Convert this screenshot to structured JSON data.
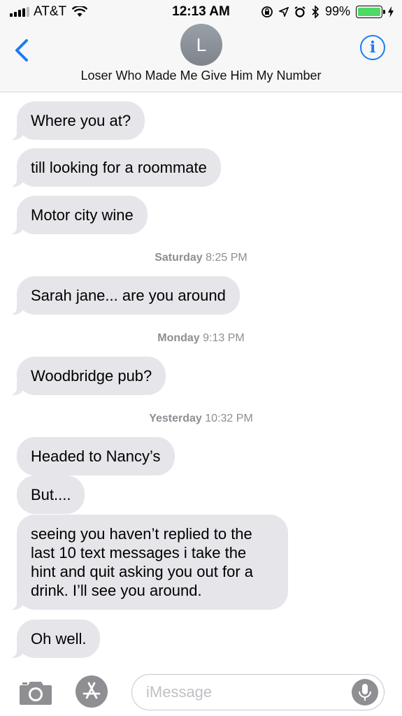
{
  "status_bar": {
    "carrier": "AT&T",
    "time": "12:13 AM",
    "battery_percent": "99%",
    "battery_level": 0.99,
    "icons": [
      "signal-icon",
      "wifi-icon",
      "rotation-lock-icon",
      "location-icon",
      "alarm-icon",
      "bluetooth-icon",
      "battery-icon",
      "charging-icon"
    ]
  },
  "header": {
    "back_icon": "chevron-left-icon",
    "avatar_initial": "L",
    "contact_name": "Loser Who Made Me Give Him My Number",
    "info_icon": "info-icon",
    "info_symbol": "i"
  },
  "messages": [
    {
      "text": "Where you at?"
    },
    {
      "text": "till looking for a roommate"
    },
    {
      "text": "Motor city wine"
    },
    {
      "timestamp_day": "Saturday",
      "timestamp_time": "8:25 PM"
    },
    {
      "text": "Sarah jane... are you around"
    },
    {
      "timestamp_day": "Monday",
      "timestamp_time": "9:13 PM"
    },
    {
      "text": "Woodbridge pub?"
    },
    {
      "timestamp_day": "Yesterday",
      "timestamp_time": "10:32 PM"
    },
    {
      "text": "Headed to Nancy’s"
    },
    {
      "text": "But...."
    },
    {
      "text": "seeing you haven’t replied to the last 10 text messages i take the hint and quit asking you out for a drink. I’ll see you around."
    },
    {
      "text": "Oh well."
    }
  ],
  "input_bar": {
    "camera_icon": "camera-icon",
    "apps_icon": "app-store-icon",
    "placeholder": "iMessage",
    "mic_icon": "microphone-icon"
  },
  "colors": {
    "accent": "#1a7cf5",
    "bubble_received": "#e5e5ea",
    "battery_green": "#4cd964",
    "timestamp_gray": "#8e8e93"
  }
}
